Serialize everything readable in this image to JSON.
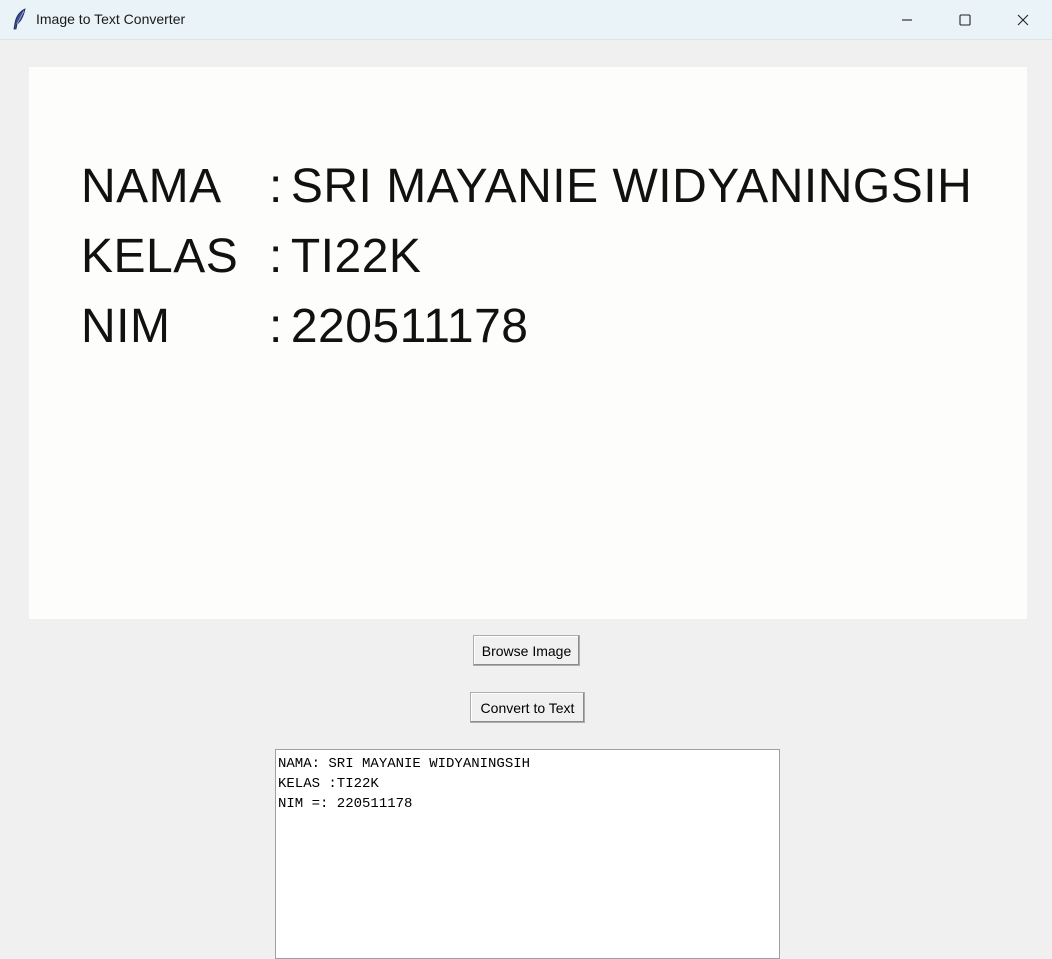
{
  "window": {
    "title": "Image to Text Converter",
    "icon": "feather-icon",
    "controls": [
      "minimize-icon",
      "maximize-icon",
      "close-icon"
    ]
  },
  "image_preview": {
    "rows": [
      {
        "label": "NAMA",
        "separator": ":",
        "value": "SRI MAYANIE WIDYANINGSIH"
      },
      {
        "label": "KELAS",
        "separator": ":",
        "value": "TI22K"
      },
      {
        "label": "NIM",
        "separator": ":",
        "value": "220511178"
      }
    ]
  },
  "buttons": {
    "browse_label": "Browse Image",
    "convert_label": "Convert to Text"
  },
  "output": {
    "lines": [
      "NAMA: SRI MAYANIE WIDYANINGSIH",
      "KELAS :TI22K",
      "NIM =: 220511178"
    ]
  },
  "colors": {
    "window_bg": "#f0f0f0",
    "titlebar_bg": "#eaf3f7",
    "panel_bg": "#fdfdfc"
  }
}
